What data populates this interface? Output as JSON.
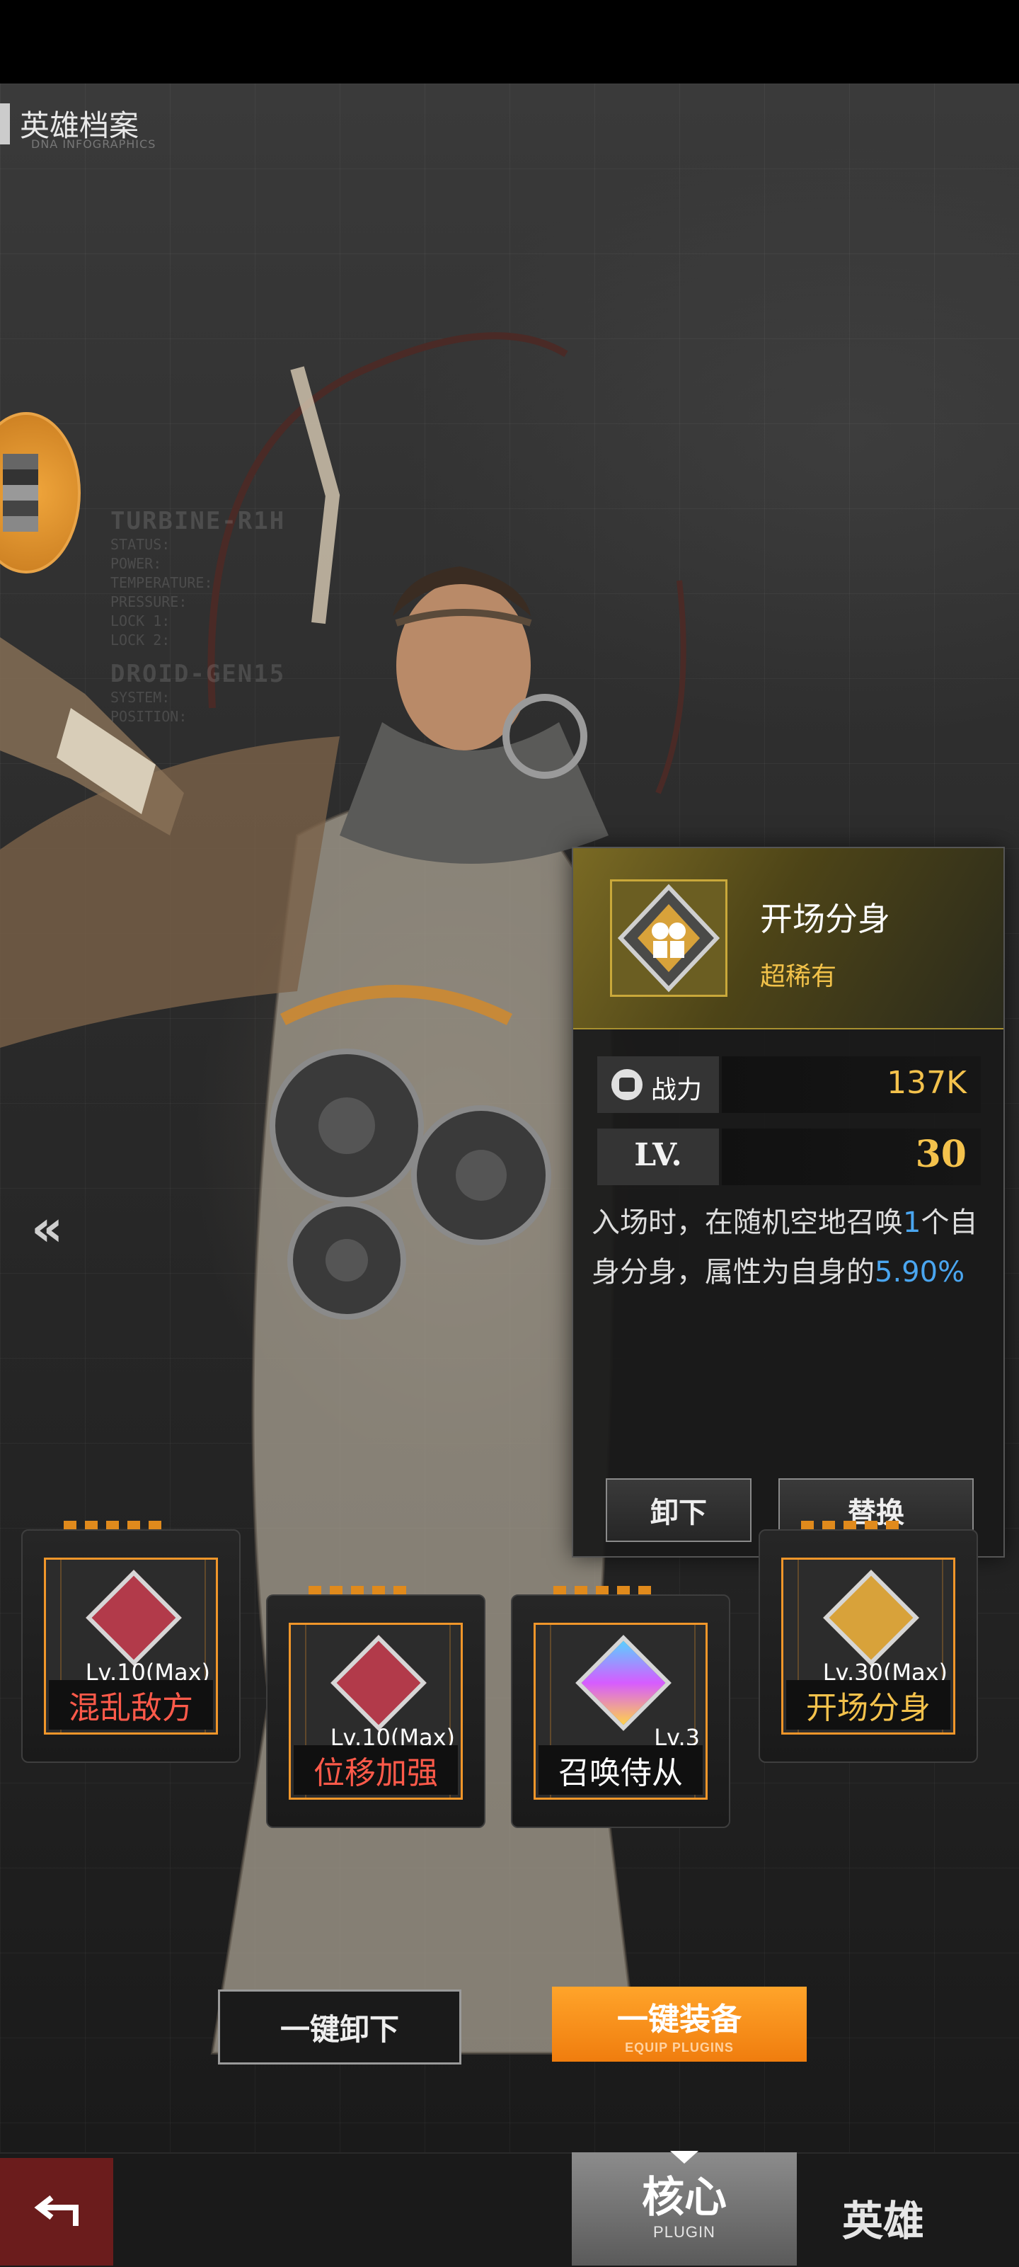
{
  "header": {
    "title": "英雄档案",
    "subtitle": "DNA INFOGRAPHICS"
  },
  "hud": {
    "block1_title": "TURBINE-R1H",
    "block1_lines": [
      "STATUS:",
      "POWER:",
      "TEMPERATURE:",
      "PRESSURE:",
      "LOCK 1:",
      "LOCK 2:"
    ],
    "block2_title": "DROID-GEN15",
    "block2_lines": [
      "SYSTEM:",
      "POSITION:"
    ]
  },
  "skill_card": {
    "name": "开场分身",
    "rarity": "超稀有",
    "power_label": "战力",
    "power_value": "137K",
    "level_label": "LV.",
    "level_value": "30",
    "description": {
      "part1": "入场时，在随机空地召唤",
      "count": "1",
      "part2": "个自身分身，属性为自身的",
      "percent": "5.90%"
    },
    "unequip_button": "卸下",
    "replace_button": "替换"
  },
  "plugins": [
    {
      "level": "Lv.10(Max)",
      "name": "混乱敌方",
      "name_color": "#ff5a4a"
    },
    {
      "level": "Lv.10(Max)",
      "name": "位移加强",
      "name_color": "#ff5a4a"
    },
    {
      "level": "Lv.3",
      "name": "召唤侍从",
      "name_color": "#ffffff"
    },
    {
      "level": "Lv.30(Max)",
      "name": "开场分身",
      "name_color": "#f4c24c"
    }
  ],
  "actions": {
    "unequip_all": "一键卸下",
    "equip_all": "一键装备",
    "equip_all_sub": "EQUIP PLUGINS"
  },
  "bottom_nav": {
    "core_tab": "核心",
    "core_tab_sub": "PLUGIN",
    "hero_tab": "英雄"
  },
  "icons": {
    "back": "return-arrow-icon",
    "collapse": "double-chevron-left-icon",
    "power": "fist-icon"
  },
  "colors": {
    "accent_orange": "#f0962a",
    "gold": "#f4c24c",
    "highlight_blue": "#4aa6f0",
    "red_text": "#ff5a4a"
  }
}
